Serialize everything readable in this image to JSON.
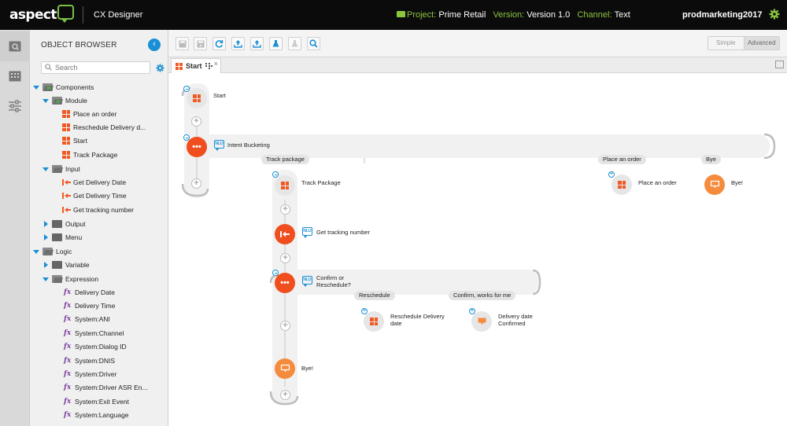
{
  "header": {
    "logo_text": "aspect",
    "app_name": "CX Designer",
    "project_label": "Project:",
    "project_value": "Prime Retail",
    "version_label": "Version:",
    "version_value": "Version 1.0",
    "channel_label": "Channel:",
    "channel_value": "Text",
    "user": "prodmarketing2017"
  },
  "browser": {
    "title": "OBJECT BROWSER",
    "search_placeholder": "Search",
    "tree": [
      {
        "label": "Components"
      },
      {
        "label": "Module"
      },
      {
        "label": "Place an order"
      },
      {
        "label": "Reschedule Delivery d..."
      },
      {
        "label": "Start"
      },
      {
        "label": "Track Package"
      },
      {
        "label": "Input"
      },
      {
        "label": "Get Delivery Date"
      },
      {
        "label": "Get Delivery Time"
      },
      {
        "label": "Get tracking number"
      },
      {
        "label": "Output"
      },
      {
        "label": "Menu"
      },
      {
        "label": "Logic"
      },
      {
        "label": "Variable"
      },
      {
        "label": "Expression"
      },
      {
        "label": "Delivery Date"
      },
      {
        "label": "Delivery Time"
      },
      {
        "label": "System:ANI"
      },
      {
        "label": "System:Channel"
      },
      {
        "label": "System:Dialog ID"
      },
      {
        "label": "System:DNIS"
      },
      {
        "label": "System:Driver"
      },
      {
        "label": "System:Driver ASR En..."
      },
      {
        "label": "System:Exit Event"
      },
      {
        "label": "System:Language"
      }
    ]
  },
  "toolbar": {
    "simple_label": "Simple",
    "advanced_label": "Advanced"
  },
  "tab": {
    "label": "Start",
    "close": "×"
  },
  "flow": {
    "start": "Start",
    "intent_bucketing": "Intent Bucketing",
    "branch_track": "Track package",
    "branch_place": "Place an order",
    "branch_bye": "Bye",
    "track_package": "Track Package",
    "place_an_order": "Place an order",
    "bye1": "Bye!",
    "get_tracking": "Get tracking number",
    "confirm": "Confirm or\nReschedule?",
    "branch_reschedule": "Reschedule",
    "branch_confirm": "Confirm, works for me",
    "reschedule_delivery": "Reschedule Delivery\ndate",
    "delivery_confirmed": "Delivery date\nConfirmed",
    "bye2": "Bye!",
    "nlu": "NLU",
    "dots": "•••"
  },
  "colors": {
    "accent_green": "#8cc63f",
    "accent_blue": "#1a8fd4",
    "node_red": "#f04e1e",
    "node_orange": "#f58b3c",
    "module_orange": "#f15a24",
    "expression_purple": "#7b3f9e"
  }
}
